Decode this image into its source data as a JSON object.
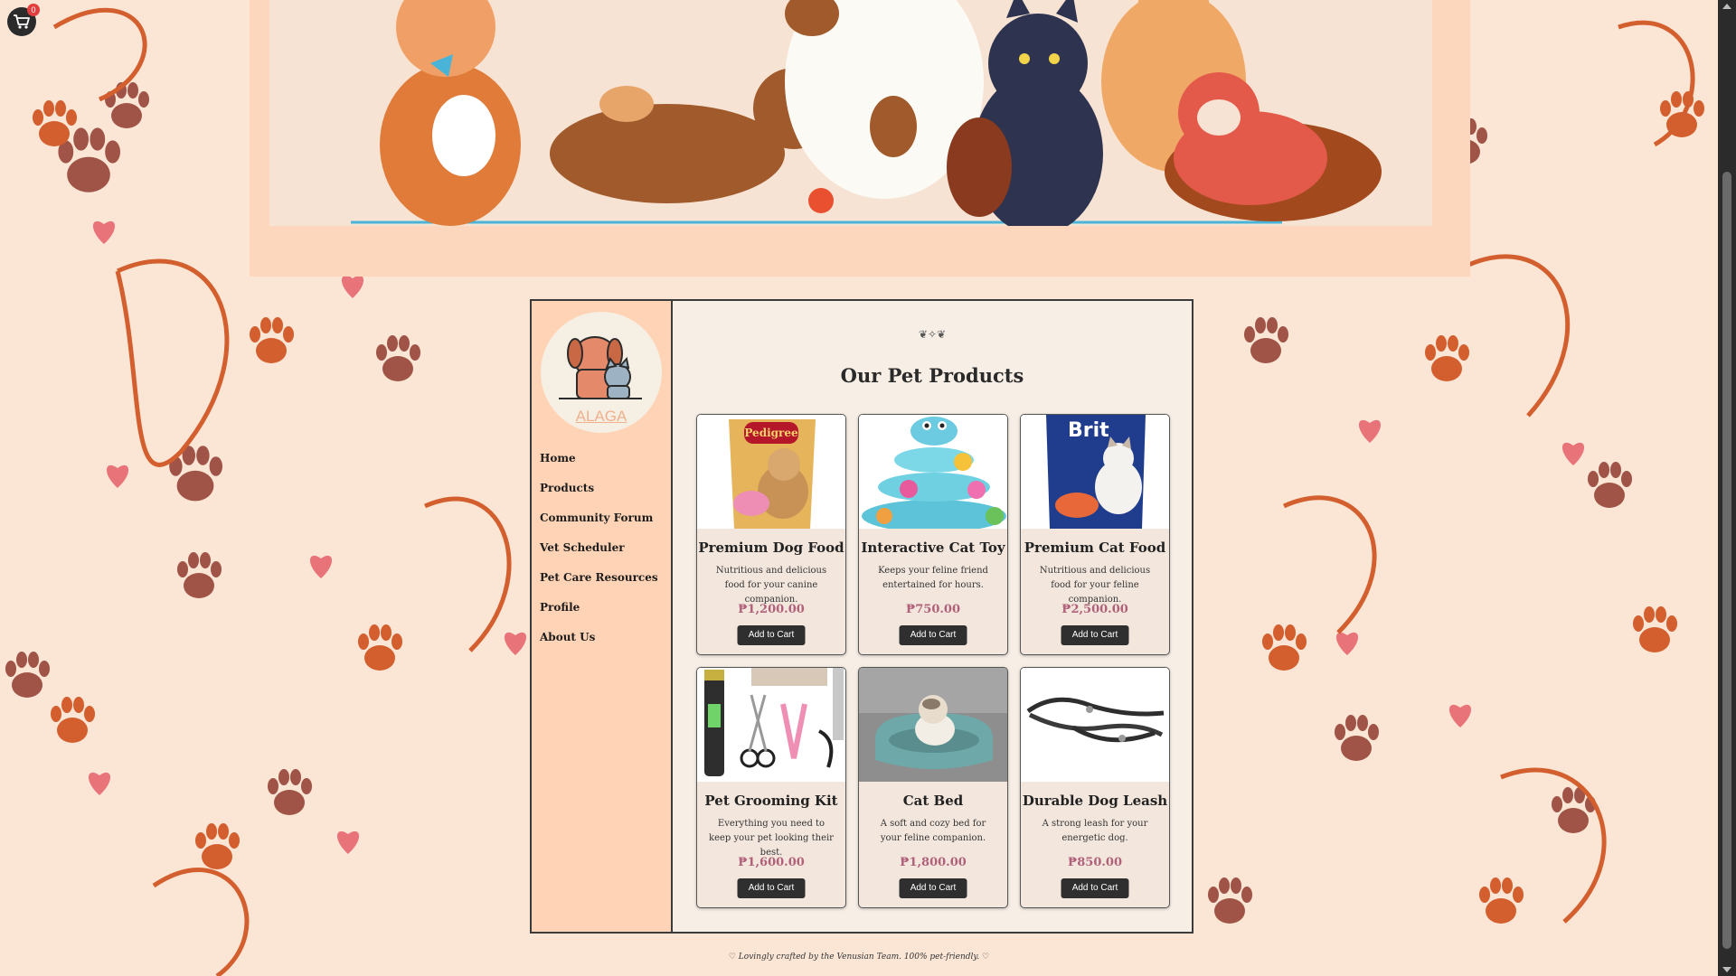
{
  "header": {
    "cart_count": "0"
  },
  "brand": {
    "logo_text": "ALAGA"
  },
  "nav": {
    "items": [
      {
        "label": "Home"
      },
      {
        "label": "Products"
      },
      {
        "label": "Community Forum"
      },
      {
        "label": "Vet Scheduler"
      },
      {
        "label": "Pet Care Resources"
      },
      {
        "label": "Profile"
      },
      {
        "label": "About Us"
      }
    ]
  },
  "main": {
    "ornament": "❦✧❦",
    "title": "Our Pet Products",
    "products": [
      {
        "name": "Premium Dog Food",
        "desc": "Nutritious and delicious food for your canine companion.",
        "price": "₱1,200.00",
        "button": "Add to Cart",
        "image_label": "Pedigree"
      },
      {
        "name": "Interactive Cat Toy",
        "desc": "Keeps your feline friend entertained for hours.",
        "price": "₱750.00",
        "button": "Add to Cart",
        "image_label": ""
      },
      {
        "name": "Premium Cat Food",
        "desc": "Nutritious and delicious food for your feline companion.",
        "price": "₱2,500.00",
        "button": "Add to Cart",
        "image_label": "Brit"
      },
      {
        "name": "Pet Grooming Kit",
        "desc": "Everything you need to keep your pet looking their best.",
        "price": "₱1,600.00",
        "button": "Add to Cart",
        "image_label": ""
      },
      {
        "name": "Cat Bed",
        "desc": "A soft and cozy bed for your feline companion.",
        "price": "₱1,800.00",
        "button": "Add to Cart",
        "image_label": ""
      },
      {
        "name": "Durable Dog Leash",
        "desc": "A strong leash for your energetic dog.",
        "price": "₱850.00",
        "button": "Add to Cart",
        "image_label": ""
      }
    ]
  },
  "footer": {
    "text": "♡ Lovingly crafted by the Venusian Team. 100% pet-friendly. ♡"
  },
  "colors": {
    "accent": "#d35f2f",
    "paw_dark": "#a05448",
    "sidebar": "#ffd3b5",
    "button": "#2f2f2f",
    "price": "#b0617a"
  }
}
